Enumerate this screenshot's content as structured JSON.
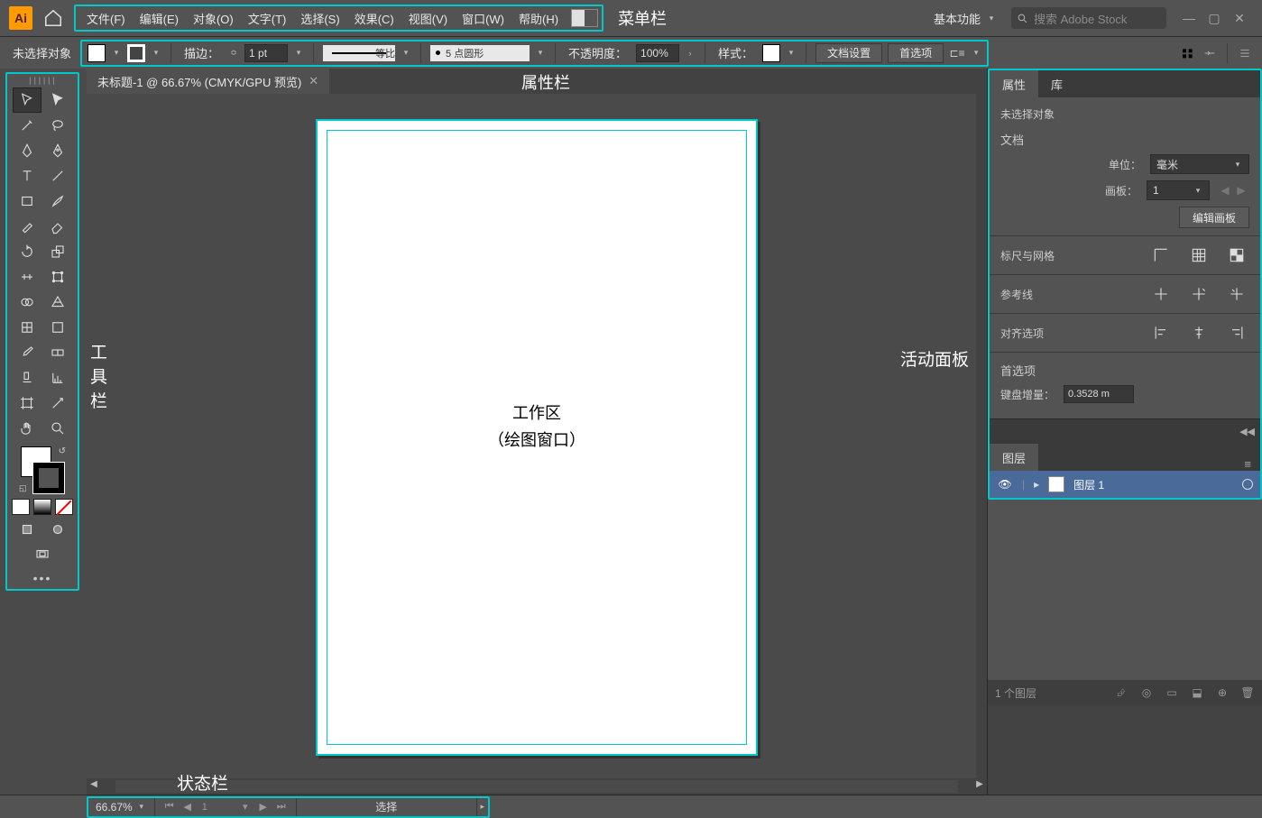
{
  "app": {
    "logo": "Ai"
  },
  "menu": {
    "items": [
      "文件(F)",
      "编辑(E)",
      "对象(O)",
      "文字(T)",
      "选择(S)",
      "效果(C)",
      "视图(V)",
      "窗口(W)",
      "帮助(H)"
    ],
    "anno": "菜单栏"
  },
  "workspace": {
    "name": "基本功能"
  },
  "search": {
    "placeholder": "搜索 Adobe Stock"
  },
  "options": {
    "no_selection": "未选择对象",
    "stroke_label": "描边：",
    "stroke_weight": "1 pt",
    "ratio": "等比",
    "brush": "5 点圆形",
    "opacity_label": "不透明度：",
    "opacity": "100%",
    "style_label": "样式：",
    "btn_docsetup": "文档设置",
    "btn_prefs": "首选项",
    "anno": "属性栏"
  },
  "doc": {
    "tab": "未标题-1 @ 66.67% (CMYK/GPU 预览)"
  },
  "artboard": {
    "line1": "工作区",
    "line2": "（绘图窗口）"
  },
  "anno": {
    "tools": "工具栏",
    "panels": "活动面板",
    "status": "状态栏"
  },
  "properties": {
    "tab_props": "属性",
    "tab_lib": "库",
    "no_sel": "未选择对象",
    "sec_doc": "文档",
    "unit_label": "单位：",
    "unit_value": "毫米",
    "artboard_label": "画板：",
    "artboard_value": "1",
    "edit_artboard": "编辑画板",
    "sec_rg": "标尺与网格",
    "sec_guides": "参考线",
    "sec_align": "对齐选项",
    "sec_prefs": "首选项",
    "kb_label": "键盘增量：",
    "kb_value": "0.3528 m"
  },
  "layers": {
    "tab": "图层",
    "layer1": "图层 1",
    "count": "1 个图层"
  },
  "status": {
    "zoom": "66.67%",
    "page": "1",
    "sel": "选择"
  }
}
